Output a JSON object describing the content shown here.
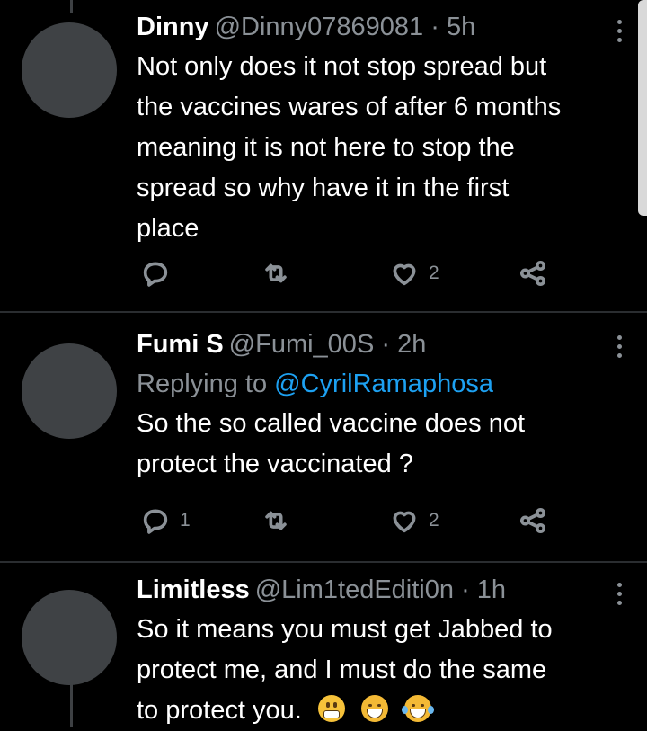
{
  "tweets": [
    {
      "display_name": "Dinny",
      "handle": "@Dinny07869081",
      "separator": "·",
      "time": "5h",
      "replying_to_label": "",
      "replying_to_mention": "",
      "lines": [
        "Not only does it not stop spread but",
        "the vaccines wares of after 6 months",
        "meaning it is not here to stop the",
        "spread so why have it in the first",
        "place"
      ],
      "reply_count": "",
      "like_count": "2"
    },
    {
      "display_name": "Fumi S",
      "handle": "@Fumi_00S",
      "separator": "·",
      "time": "2h",
      "replying_to_label": "Replying to",
      "replying_to_mention": "@CyrilRamaphosa",
      "lines": [
        "So the so called vaccine does not",
        "protect the vaccinated ?"
      ],
      "reply_count": "1",
      "like_count": "2"
    },
    {
      "display_name": "Limitless",
      "handle": "@Lim1tedEditi0n",
      "separator": "·",
      "time": "1h",
      "replying_to_label": "",
      "replying_to_mention": "",
      "lines": [
        "So it means you must get Jabbed to",
        "protect me, and I must do the same",
        "to protect you."
      ],
      "emojis": [
        "grimacing-face-emoji",
        "laughing-face-emoji",
        "tears-of-joy-emoji"
      ]
    }
  ],
  "icons": {
    "reply": "reply-icon",
    "retweet": "retweet-icon",
    "like": "heart-icon",
    "share": "share-icon",
    "more": "more-vertical-icon"
  },
  "colors": {
    "background": "#000000",
    "text": "#ffffff",
    "secondary_text": "#8b9197",
    "link": "#1da1f2",
    "avatar_placeholder": "#3f4245",
    "divider": "#2a2d30"
  }
}
